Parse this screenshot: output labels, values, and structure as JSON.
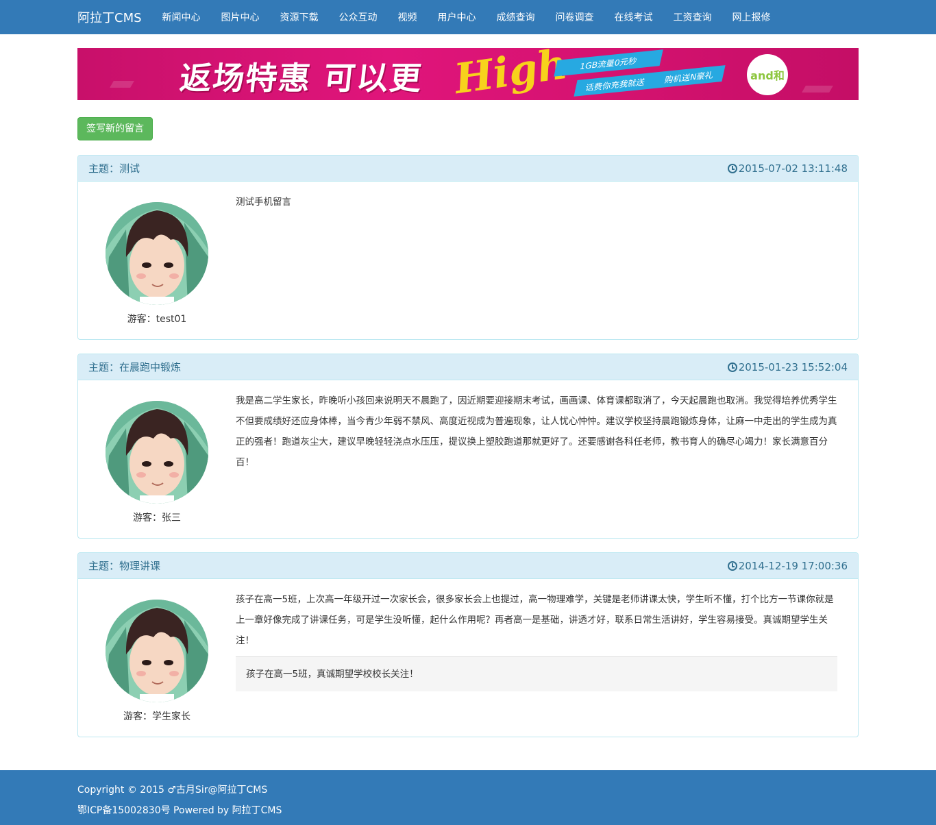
{
  "navbar": {
    "brand": "阿拉丁CMS",
    "items": [
      {
        "label": "新闻中心"
      },
      {
        "label": "图片中心"
      },
      {
        "label": "资源下载"
      },
      {
        "label": "公众互动"
      },
      {
        "label": "视频"
      },
      {
        "label": "用户中心"
      },
      {
        "label": "成绩查询"
      },
      {
        "label": "问卷调查"
      },
      {
        "label": "在线考试"
      },
      {
        "label": "工资查询"
      },
      {
        "label": "网上报修"
      }
    ],
    "color": "#337ab7"
  },
  "banner": {
    "main_text": "返场特惠 可以更",
    "highlight_text": "High",
    "line1": "1GB流量0元秒",
    "line2a": "话费你充我就送",
    "line2b": "购机送N豪礼",
    "logo_text": "and和"
  },
  "new_message_button": "签写新的留言",
  "posts": [
    {
      "subject": "主题：测试",
      "time": "2015-07-02 13:11:48",
      "author": "游客：test01",
      "content": "测试手机留言",
      "reply": null
    },
    {
      "subject": "主题：在晨跑中锻炼",
      "time": "2015-01-23 15:52:04",
      "author": "游客：张三",
      "content": "我是高二学生家长，昨晚听小孩回来说明天不晨跑了，因近期要迎接期末考试，画画课、体育课都取消了，今天起晨跑也取消。我觉得培养优秀学生不但要成绩好还应身体棒，当今青少年弱不禁风、高度近视成为普遍现象，让人忧心忡忡。建议学校坚持晨跑锻炼身体，让麻一中走出的学生成为真正的强者！跑道灰尘大，建议早晚轻轻浇点水压压，提议换上塑胶跑道那就更好了。还要感谢各科任老师，教书育人的确尽心竭力！家长满意百分百！",
      "reply": null
    },
    {
      "subject": "主题：物理讲课",
      "time": "2014-12-19 17:00:36",
      "author": "游客：学生家长",
      "content": "孩子在高一5班，上次高一年级开过一次家长会，很多家长会上也提过，高一物理难学，关键是老师讲课太快，学生听不懂，打个比方一节课你就是上一章好像完成了讲课任务，可是学生没听懂，起什么作用呢？再者高一是基础，讲透才好，联系日常生活讲好，学生容易接受。真诚期望学生关注！",
      "reply": "孩子在高一5班，真诚期望学校校长关注！"
    }
  ],
  "footer": {
    "copyright": "Copyright © 2015 ♂古月Sir@阿拉丁CMS",
    "icp": "鄂ICP备15002830号 Powered by 阿拉丁CMS"
  }
}
